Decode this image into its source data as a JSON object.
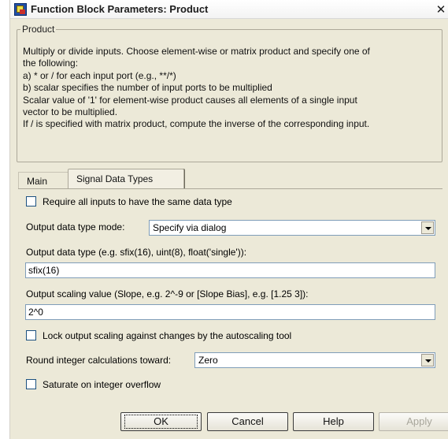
{
  "window": {
    "title": "Function Block Parameters: Product",
    "close_glyph": "✕"
  },
  "group": {
    "label": "Product",
    "description_lines": [
      "Multiply or divide inputs.  Choose element-wise or matrix product and specify one of",
      "the following:",
      "a) * or / for each input port (e.g., **/*)",
      "b) scalar specifies the number of input ports to be multiplied",
      "Scalar value of '1' for element-wise product causes all elements of a single input",
      "vector to be multiplied.",
      "If / is specified with matrix product, compute the inverse of the corresponding input."
    ]
  },
  "tabs": [
    {
      "label": "Main",
      "active": false
    },
    {
      "label": "Signal Data Types",
      "active": true
    }
  ],
  "signal_data_types": {
    "require_same_type": {
      "label": "Require all inputs to have the same data type",
      "checked": false
    },
    "output_mode": {
      "label": "Output data type mode:",
      "value": "Specify via dialog"
    },
    "output_type": {
      "label": "Output data type (e.g. sfix(16), uint(8), float('single')):",
      "value": "sfix(16)"
    },
    "output_scaling": {
      "label": "Output scaling value (Slope, e.g. 2^-9 or [Slope Bias], e.g. [1.25 3]):",
      "value": "2^0"
    },
    "lock_scaling": {
      "label": "Lock output scaling against changes by the autoscaling tool",
      "checked": false
    },
    "round": {
      "label": "Round integer calculations toward:",
      "value": "Zero"
    },
    "saturate": {
      "label": "Saturate on integer overflow",
      "checked": false
    }
  },
  "buttons": {
    "ok": "OK",
    "cancel": "Cancel",
    "help": "Help",
    "apply": "Apply"
  },
  "icons": {
    "app": "simulink-block-icon",
    "close": "close-icon",
    "dropdown": "chevron-down-icon"
  },
  "colors": {
    "dialog_bg": "#ece9d8",
    "field_border": "#7f9db9",
    "disabled_text": "#a8a69b"
  }
}
